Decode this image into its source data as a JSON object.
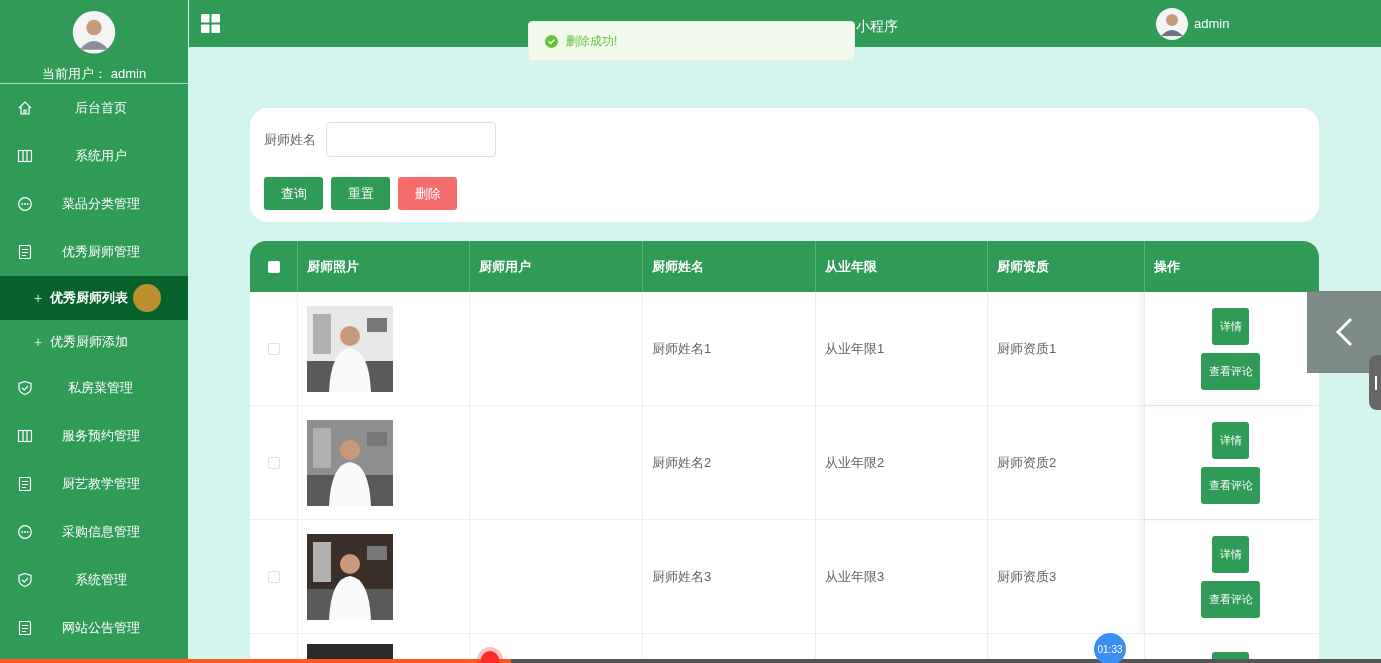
{
  "sidebar": {
    "current_user_label": "当前用户：",
    "current_user": "admin",
    "items": [
      {
        "label": "后台首页",
        "selected": false
      },
      {
        "label": "系统用户",
        "selected": false
      },
      {
        "label": "菜品分类管理",
        "selected": false
      },
      {
        "label": "优秀厨师管理",
        "selected": false,
        "expanded": true,
        "children": [
          {
            "bullet": "+",
            "label": "优秀厨师列表",
            "selected": true
          },
          {
            "bullet": "+",
            "label": "优秀厨师添加",
            "selected": false
          }
        ]
      },
      {
        "label": "私房菜管理",
        "selected": false
      },
      {
        "label": "服务预约管理",
        "selected": false
      },
      {
        "label": "厨艺教学管理",
        "selected": false
      },
      {
        "label": "采购信息管理",
        "selected": false
      },
      {
        "label": "系统管理",
        "selected": false
      },
      {
        "label": "网站公告管理",
        "selected": false
      }
    ]
  },
  "header": {
    "title_visible": "小程序",
    "user": "admin"
  },
  "toast": {
    "message": "删除成功!"
  },
  "search": {
    "label": "厨师姓名",
    "buttons": [
      {
        "label": "查询",
        "kind": "primary"
      },
      {
        "label": "重置",
        "kind": "primary"
      },
      {
        "label": "删除",
        "kind": "danger"
      }
    ]
  },
  "table": {
    "all_checked": false,
    "columns": [
      "厨师照片",
      "厨师用户",
      "厨师姓名",
      "从业年限",
      "厨师资质",
      "操作"
    ],
    "rows": [
      {
        "checked": false,
        "photo": {
          "kind": "picture"
        },
        "name": "厨师姓名1",
        "years": "从业年限1",
        "qualification": "厨师资质1",
        "actions": [
          "详情",
          "查看评论"
        ]
      },
      {
        "checked": false,
        "photo": {
          "kind": "picture"
        },
        "name": "厨师姓名2",
        "years": "从业年限2",
        "qualification": "厨师资质2",
        "actions": [
          "详情",
          "查看评论"
        ]
      },
      {
        "checked": false,
        "photo": {
          "kind": "picture"
        },
        "name": "厨师姓名3",
        "years": "从业年限3",
        "qualification": "厨师资质3",
        "actions": [
          "详情",
          "查看评论"
        ]
      }
    ]
  },
  "player": {
    "progress": {
      "level": 0.37
    },
    "timer": "01:33"
  }
}
